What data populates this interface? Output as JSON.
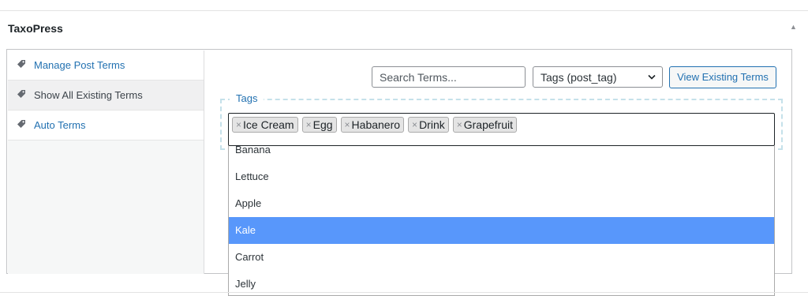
{
  "metabox": {
    "title": "TaxoPress",
    "toggle_icon": "triangle-up-icon"
  },
  "tabs": [
    {
      "label": "Manage Post Terms",
      "icon": "tag-icon",
      "active": false
    },
    {
      "label": "Show All Existing Terms",
      "icon": "tag-icon",
      "active": true
    },
    {
      "label": "Auto Terms",
      "icon": "tag-icon",
      "active": false
    }
  ],
  "toolbar": {
    "search_placeholder": "Search Terms...",
    "search_value": "",
    "taxonomy_selected": "Tags (post_tag)",
    "view_button_label": "View Existing Terms"
  },
  "tags_field": {
    "legend": "Tags",
    "chips": [
      "Ice Cream",
      "Egg",
      "Habanero",
      "Drink",
      "Grapefruit"
    ],
    "remove_symbol": "×"
  },
  "dropdown": {
    "options": [
      "Banana",
      "Lettuce",
      "Apple",
      "Kale",
      "Carrot",
      "Jelly"
    ],
    "highlighted": "Kale"
  },
  "colors": {
    "link": "#2271b1",
    "highlight": "#5897fb",
    "fieldset_border": "#c5e1ea"
  }
}
